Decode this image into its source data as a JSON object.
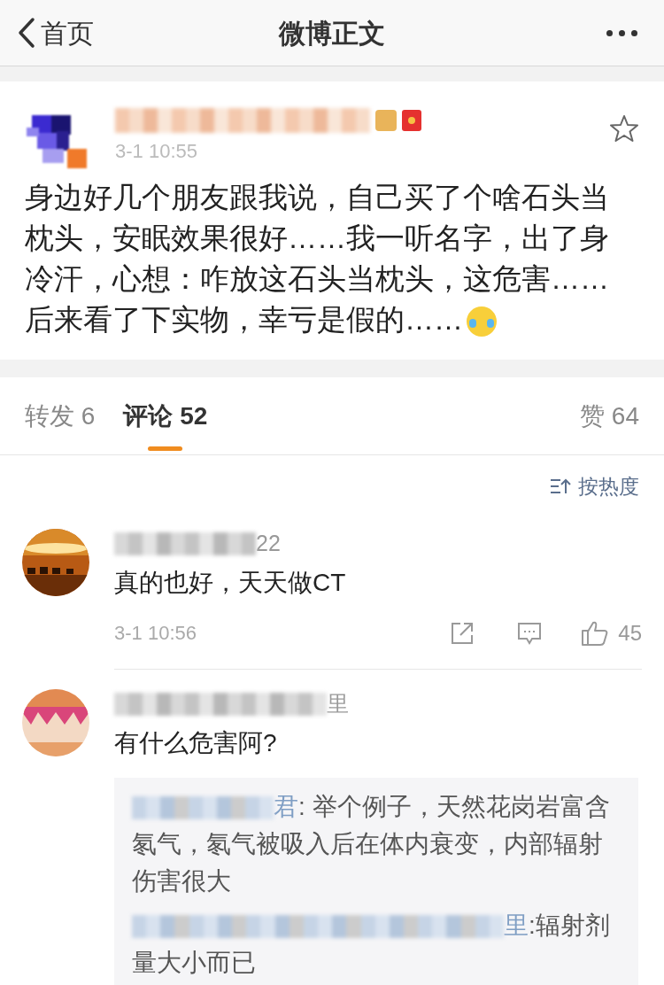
{
  "nav": {
    "back": "首页",
    "title": "微博正文"
  },
  "post": {
    "time": "3-1 10:55",
    "text": "身边好几个朋友跟我说，自己买了个啥石头当枕头，安眠效果很好……我一听名字，出了身冷汗，心想：咋放这石头当枕头，这危害……后来看了下实物，幸亏是假的……"
  },
  "tabs": [
    {
      "label": "转发 6",
      "selected": false
    },
    {
      "label": "评论 52",
      "selected": true
    }
  ],
  "likes": "赞 64",
  "sort": "按热度",
  "comments": [
    {
      "name_end": "22",
      "text": "真的也好，天天做CT",
      "time": "3-1 10:56",
      "like_count": "45"
    },
    {
      "name_end": "里",
      "text": "有什么危害阿?",
      "replies": [
        {
          "name_end": "君",
          "text": ": 举个例子，天然花岗岩富含氡气，氡气被吸入后在体内衰变，内部辐射伤害很大"
        },
        {
          "name_end": "里",
          "text": ":辐射剂量大小而已"
        }
      ]
    }
  ]
}
